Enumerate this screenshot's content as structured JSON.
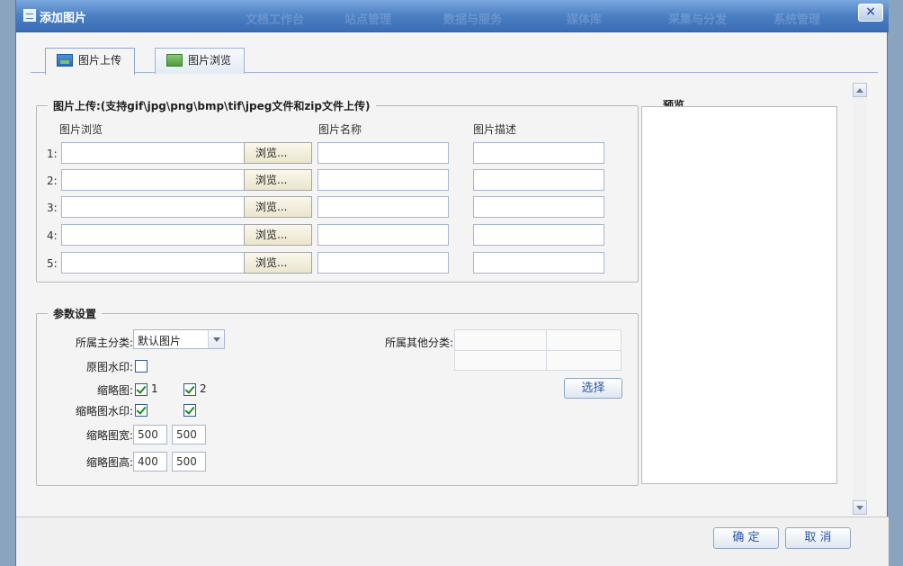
{
  "dialog": {
    "title": "添加图片",
    "close_label": "×",
    "ghost_nav": [
      "文档工作台",
      "站点管理",
      "数据与服务",
      "媒体库",
      "采集与分发",
      "系统管理"
    ]
  },
  "tabs": [
    {
      "label": "图片上传",
      "active": true
    },
    {
      "label": "图片浏览",
      "active": false
    }
  ],
  "upload": {
    "legend": "图片上传:(支持gif\\jpg\\png\\bmp\\tif\\jpeg文件和zip文件上传)",
    "col_browse": "图片浏览",
    "col_name": "图片名称",
    "col_desc": "图片描述",
    "browse_label": "浏览...",
    "rows": [
      "1:",
      "2:",
      "3:",
      "4:",
      "5:"
    ]
  },
  "params": {
    "legend": "参数设置",
    "main_category_label": "所属主分类:",
    "main_category_value": "默认图片",
    "other_category_label": "所属其他分类:",
    "watermark_label": "原图水印:",
    "thumb_label": "缩略图:",
    "thumb_opt1": "1",
    "thumb_opt2": "2",
    "thumb_watermark_label": "缩略图水印:",
    "thumb_width_label": "缩略图宽:",
    "thumb_width_1": "500",
    "thumb_width_2": "500",
    "thumb_height_label": "缩略图高:",
    "thumb_height_1": "400",
    "thumb_height_2": "500",
    "select_button": "选择"
  },
  "preview": {
    "legend": "预览"
  },
  "footer": {
    "ok": "确 定",
    "cancel": "取 消"
  }
}
